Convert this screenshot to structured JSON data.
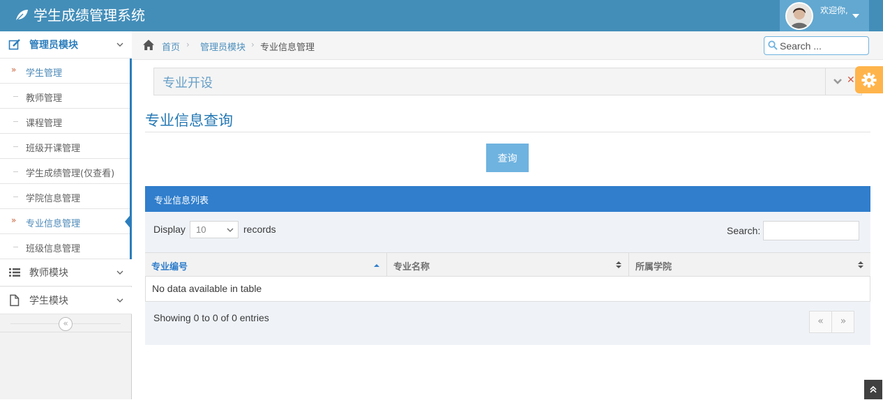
{
  "app": {
    "title": "学生成绩管理系统"
  },
  "user": {
    "welcome": "欢迎你,"
  },
  "sidebar": {
    "groups": [
      {
        "label": "管理员模块",
        "icon": "edit-icon",
        "expanded": true
      },
      {
        "label": "教师模块",
        "icon": "list-icon",
        "expanded": false
      },
      {
        "label": "学生模块",
        "icon": "file-icon",
        "expanded": false
      }
    ],
    "items": [
      {
        "label": "学生管理"
      },
      {
        "label": "教师管理"
      },
      {
        "label": "课程管理"
      },
      {
        "label": "班级开课管理"
      },
      {
        "label": "学生成绩管理(仅查看)"
      },
      {
        "label": "学院信息管理"
      },
      {
        "label": "专业信息管理"
      },
      {
        "label": "班级信息管理"
      }
    ],
    "collapse_glyph": "«"
  },
  "breadcrumb": {
    "home": "首页",
    "parent": "管理员模块",
    "current": "专业信息管理",
    "separator": "›"
  },
  "search": {
    "placeholder": "Search ..."
  },
  "widget": {
    "title": "专业开设"
  },
  "page": {
    "title": "专业信息查询",
    "query_button": "查询"
  },
  "table": {
    "panel_title": "专业信息列表",
    "display_label": "Display",
    "page_length": "10",
    "records_label": "records",
    "search_label": "Search:",
    "columns": [
      "专业编号",
      "专业名称",
      "所属学院"
    ],
    "empty_text": "No data available in table",
    "info": "Showing 0 to 0 of 0 entries",
    "prev_glyph": "«",
    "next_glyph": "»"
  },
  "colors": {
    "navbar": "#438eb9",
    "accent": "#2b7dbc",
    "table_header": "#307ecc",
    "query_button": "#6fb3e0",
    "settings": "#ffb44b"
  }
}
